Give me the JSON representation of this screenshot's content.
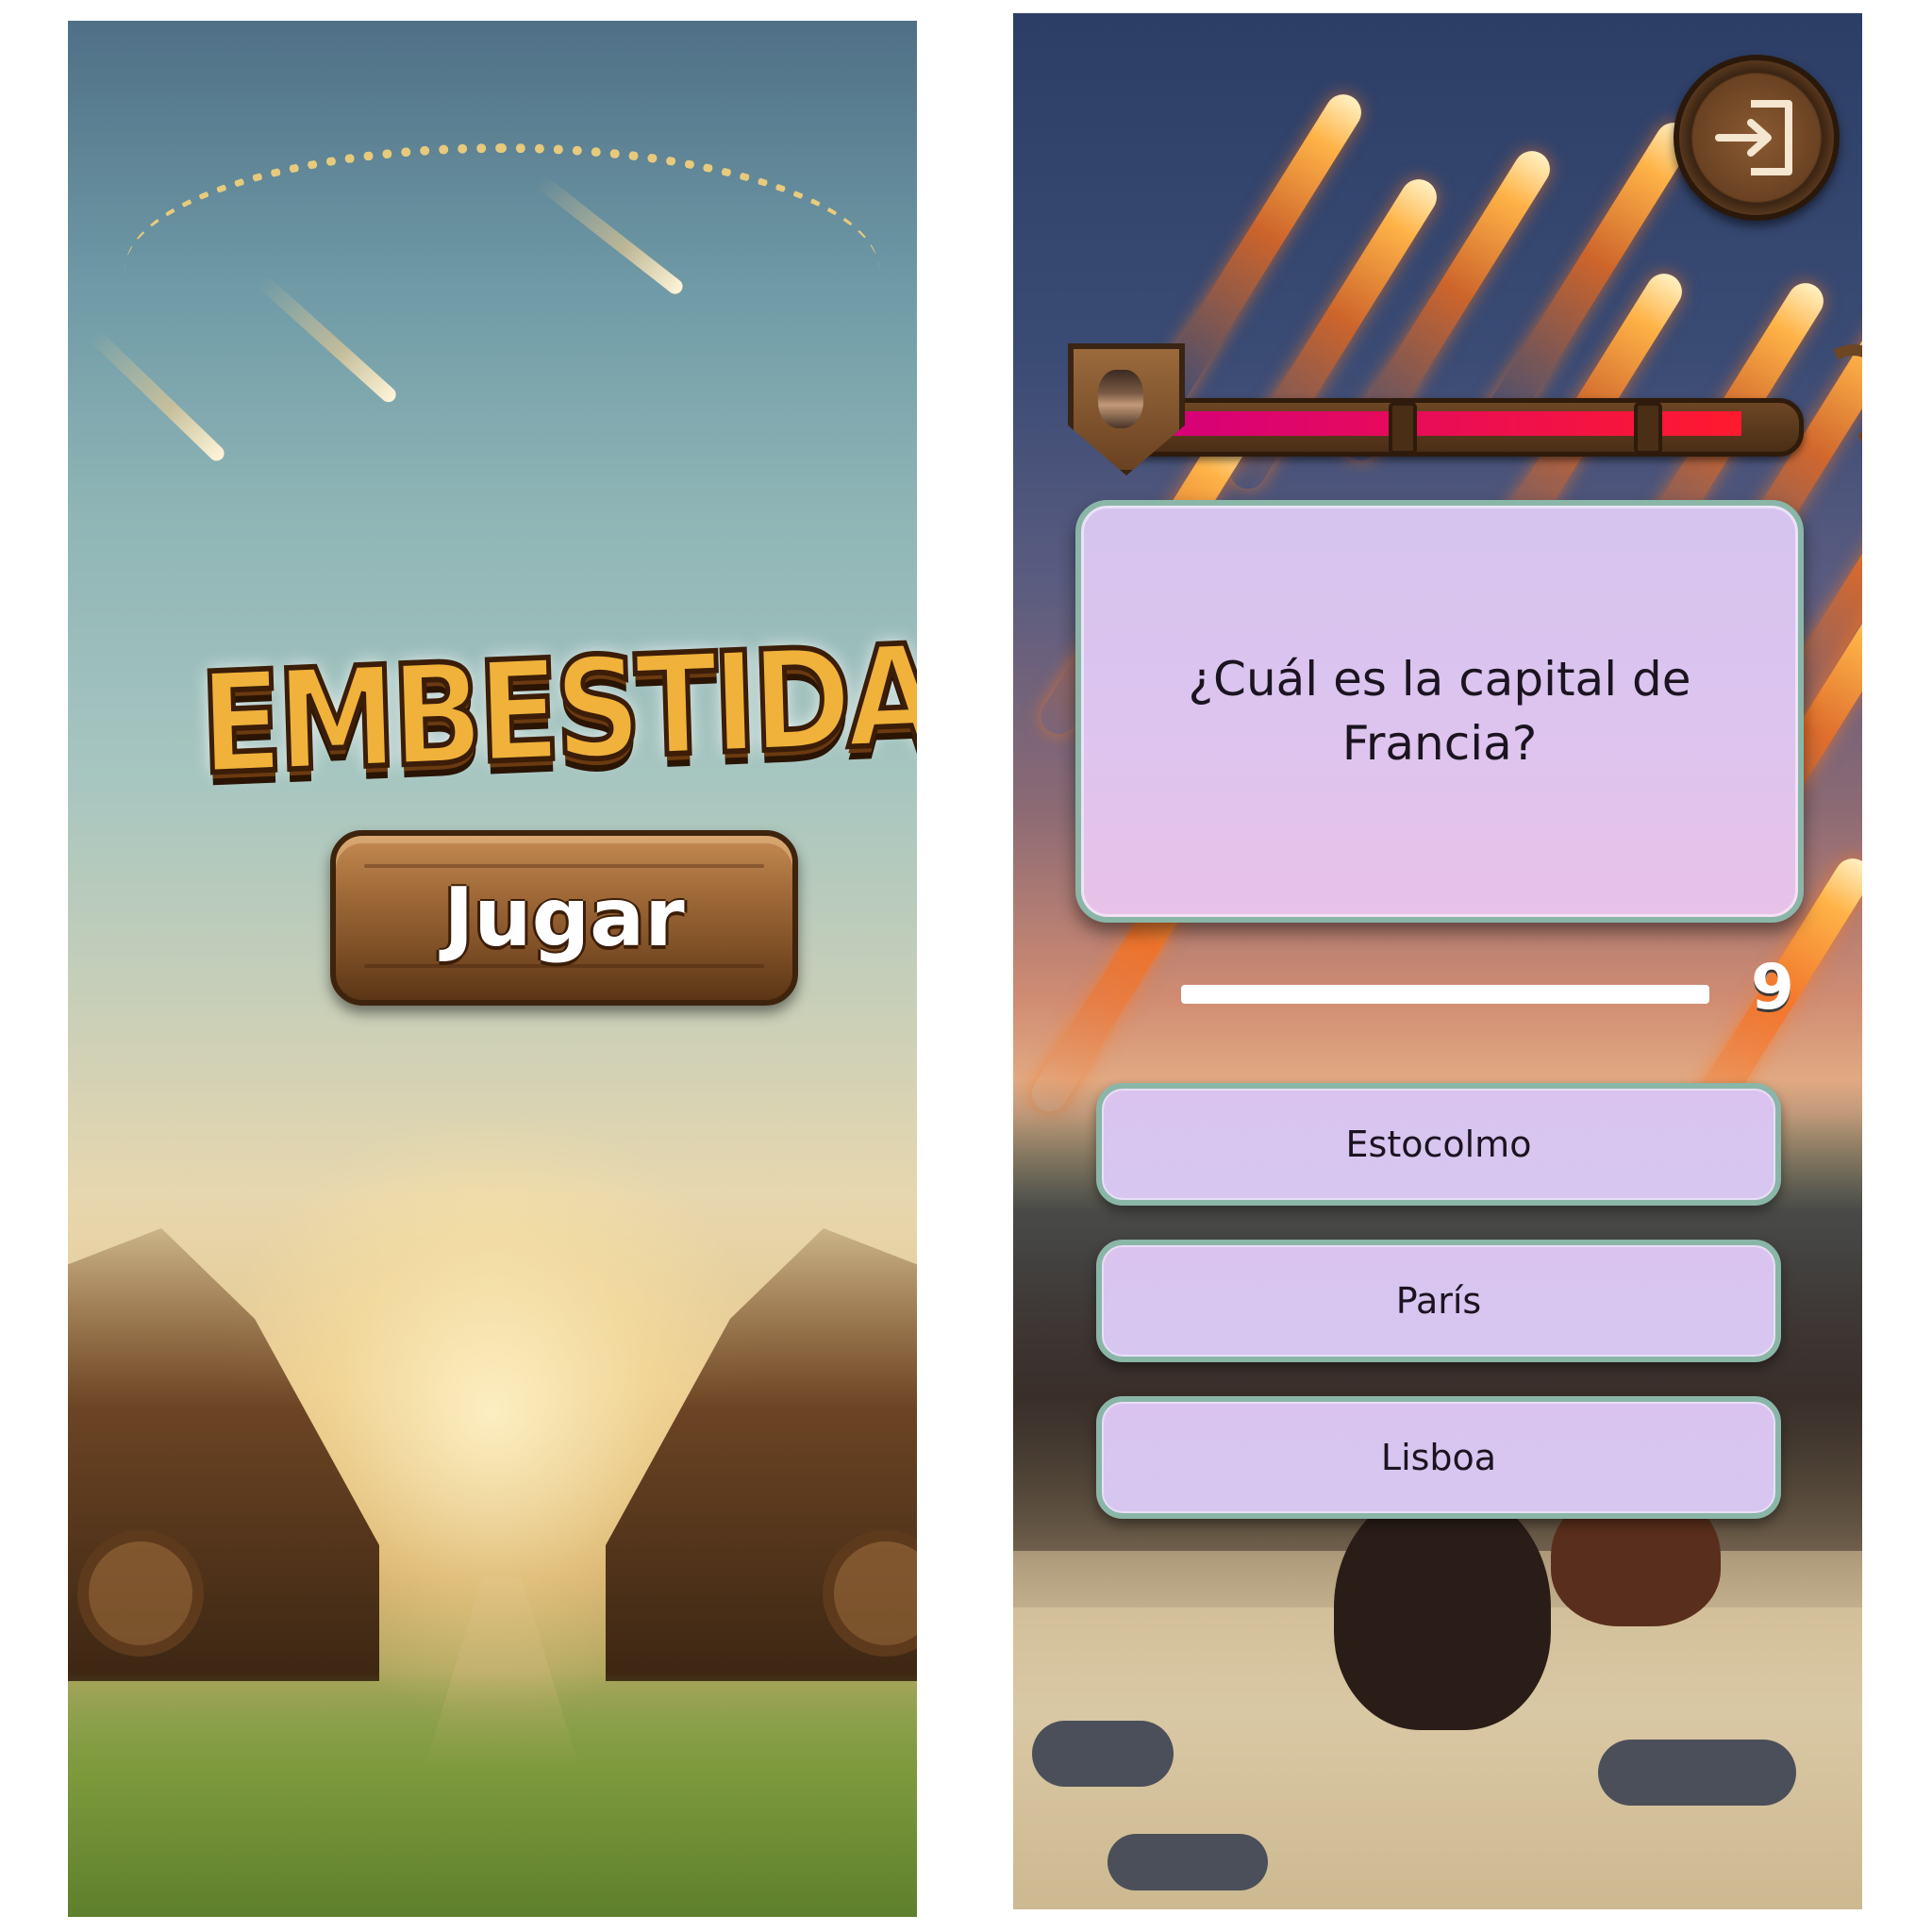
{
  "title_screen": {
    "logo_text": "EMBESTIDA",
    "play_label": "Jugar"
  },
  "quiz_screen": {
    "exit_icon": "exit-door-arrow-icon",
    "avatar_icon": "warrior-shield-icon",
    "health_level": 0.93,
    "health_colors": [
      "#d6007a",
      "#ff1a2e"
    ],
    "question": "¿Cuál es la capital de Francia?",
    "timer_level": 1.0,
    "timer_value": "9",
    "answers": [
      "Estocolmo",
      "París",
      "Lisboa"
    ]
  }
}
